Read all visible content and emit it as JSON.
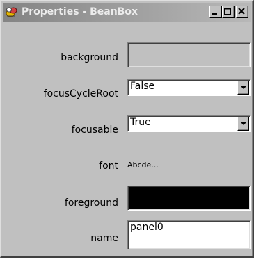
{
  "window": {
    "title": "Properties - BeanBox",
    "controls": {
      "minimize_icon": "minimize-icon",
      "maximize_icon": "maximize-icon",
      "close_icon": "close-icon"
    }
  },
  "properties": {
    "background": {
      "label": "background",
      "color": "#c0c0c0"
    },
    "focusCycleRoot": {
      "label": "focusCycleRoot",
      "value": "False"
    },
    "focusable": {
      "label": "focusable",
      "value": "True"
    },
    "font": {
      "label": "font",
      "preview": "Abcde..."
    },
    "foreground": {
      "label": "foreground",
      "color": "#000000"
    },
    "name": {
      "label": "name",
      "value": "panel0"
    }
  },
  "colors": {
    "window_face": "#c0c0c0",
    "title_gradient_left": "#848484",
    "title_gradient_right": "#b8b8b8",
    "title_text": "#ececec",
    "field_background": "#ffffff"
  }
}
